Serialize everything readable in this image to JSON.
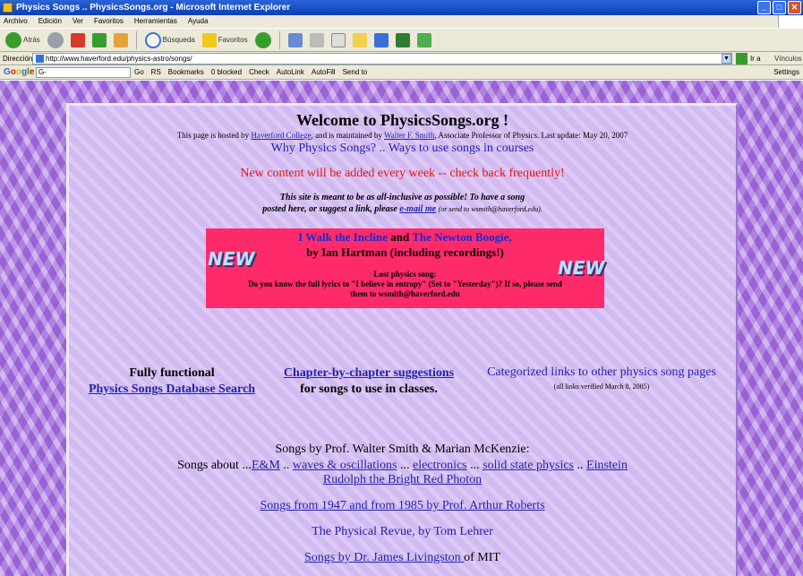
{
  "window": {
    "title": "Physics Songs .. PhysicsSongs.org - Microsoft Internet Explorer",
    "buttons": {
      "minimize": "_",
      "maximize": "□",
      "close": "✕"
    }
  },
  "menu": [
    "Archivo",
    "Edición",
    "Ver",
    "Favoritos",
    "Herramientas",
    "Ayuda"
  ],
  "toolbar": {
    "back": "Atrás",
    "search": "Búsqueda",
    "favorites": "Favoritos"
  },
  "address": {
    "label": "Dirección",
    "url": "http://www.haverford.edu/physics-astro/songs/",
    "go": "Ir a",
    "links": "Vínculos"
  },
  "google_toolbar": {
    "logo": [
      "G",
      "o",
      "o",
      "g",
      "l",
      "e"
    ],
    "search_placeholder": "G-",
    "items": [
      "Go",
      "RS",
      "Bookmarks",
      "0 blocked",
      "Check",
      "AutoLink",
      "AutoFill",
      "Send to"
    ],
    "settings": "Settings"
  },
  "page": {
    "welcome": "Welcome to PhysicsSongs.org !",
    "hosted_prefix": "This page is hosted by ",
    "hosted_link1": "Haverford College",
    "hosted_mid": ", and is maintained by ",
    "hosted_link2": "Walter F. Smith",
    "hosted_suffix": ", Associate Professor of Physics. Last update: May 20, 2007",
    "why": "Why Physics Songs? .. Ways to use songs in courses",
    "new_content": "New content will be added every week -- check back frequently!",
    "inclusive_line1": "This site is meant to be as all-inclusive as possible! To have a song",
    "inclusive_line2_prefix": "posted here, or suggest a link, please ",
    "inclusive_email": "e-mail me",
    "inclusive_small": "(or send to wsmith@haverford.edu).",
    "new_badge": "NEW",
    "feature_link1": "I Walk the Incline",
    "feature_and": " and ",
    "feature_link2": "The Newton Boogie,",
    "feature_line2": "by Ian Hartman (including recordings!)",
    "lost_title": "Lost physics song:",
    "lost_body": "Do you know the full lyrics to \"I believe in entropy\" (Set to \"Yesterday\")? If so, please send them to wsmith@haverford.edu",
    "col1_text": "Fully functional",
    "col1_link": "Physics Songs Database Search",
    "col2_link": "Chapter-by-chapter suggestions",
    "col2_text": "for songs to use in classes.",
    "col3_link": "Categorized links to other physics song pages",
    "col3_small": "(all links verified March 8, 2005)",
    "songs_by": "Songs by Prof. Walter Smith & Marian McKenzie:",
    "songs_about": "Songs about ...",
    "topic_em": "E&M",
    "topic_waves": "waves & oscillations",
    "topic_electronics": "electronics",
    "topic_solid": "solid state physics",
    "topic_einstein": "Einstein",
    "rudolph": "Rudolph the Bright Red Photon",
    "arthur": "Songs from 1947 and from 1985 by Prof. Arthur Roberts",
    "revue": "The Physical Revue, by Tom Lehrer",
    "livingston_link": "Songs by Dr. James Livingston ",
    "livingston_suffix": "of MIT"
  }
}
